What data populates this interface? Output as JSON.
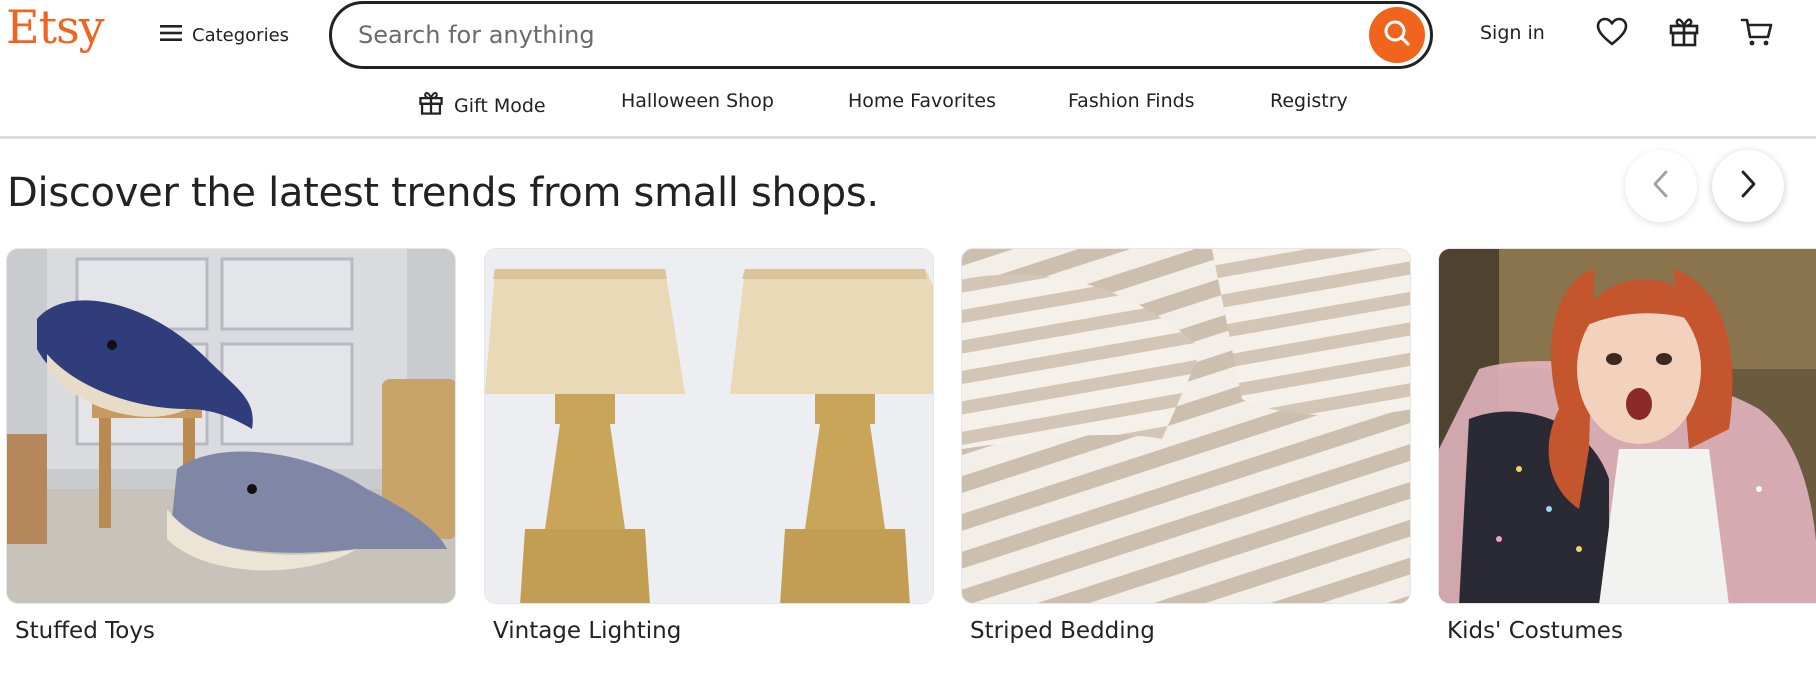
{
  "brand": {
    "logo_text": "Etsy",
    "accent_color": "#F1641E"
  },
  "header": {
    "categories_label": "Categories",
    "search": {
      "placeholder": "Search for anything",
      "value": ""
    },
    "sign_in_label": "Sign in",
    "icons": [
      "menu-icon",
      "search-icon",
      "heart-icon",
      "gift-icon",
      "cart-icon"
    ]
  },
  "subnav": {
    "items": [
      {
        "label": "Gift Mode",
        "icon": "gift-icon"
      },
      {
        "label": "Halloween Shop"
      },
      {
        "label": "Home Favorites"
      },
      {
        "label": "Fashion Finds"
      },
      {
        "label": "Registry"
      }
    ]
  },
  "discover": {
    "title": "Discover the latest trends from small shops.",
    "cards": [
      {
        "label": "Stuffed Toys"
      },
      {
        "label": "Vintage Lighting"
      },
      {
        "label": "Striped Bedding"
      },
      {
        "label": "Kids' Costumes"
      }
    ]
  }
}
